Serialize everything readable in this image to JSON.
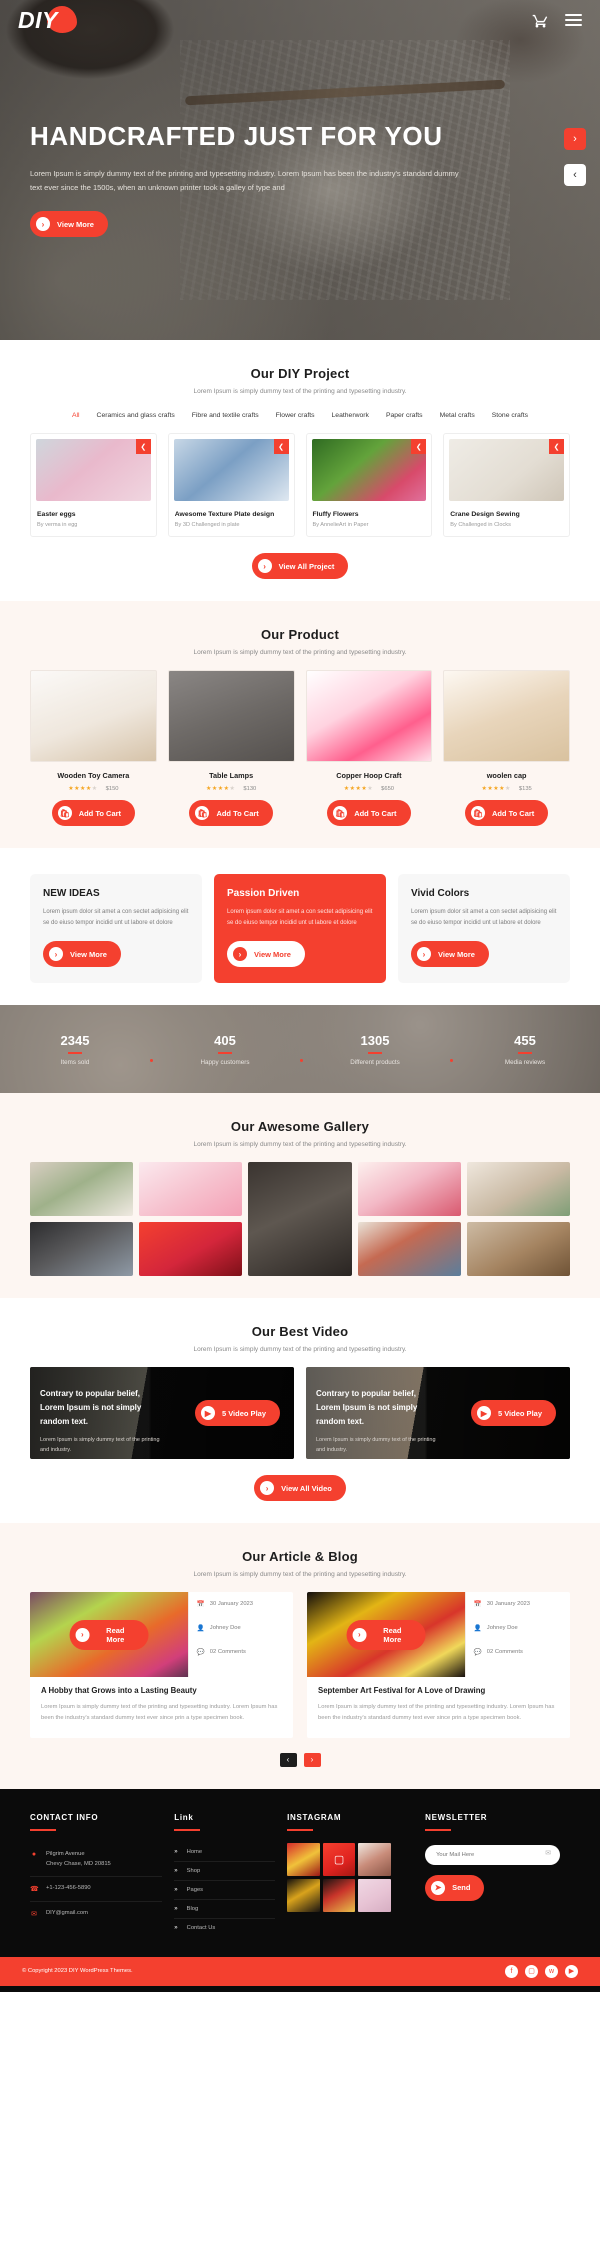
{
  "header": {
    "logo_text": "DIY",
    "cart_icon": "shopping-cart-icon",
    "menu_icon": "hamburger-menu-icon"
  },
  "hero": {
    "title": "HANDCRAFTED JUST FOR YOU",
    "subtitle": "Lorem Ipsum is simply dummy text of the printing and typesetting industry. Lorem Ipsum has been the industry's standard dummy text ever since the 1500s, when an unknown printer took a galley of type and",
    "cta_label": "View More",
    "next_label": "›",
    "prev_label": "‹"
  },
  "projects": {
    "title": "Our DIY Project",
    "subtitle": "Lorem Ipsum is simply dummy text of the printing and typesetting industry.",
    "filters": [
      {
        "label": "All",
        "active": true
      },
      {
        "label": "Ceramics and glass crafts",
        "active": false
      },
      {
        "label": "Fibre and textile crafts",
        "active": false
      },
      {
        "label": "Flower crafts",
        "active": false
      },
      {
        "label": "Leatherwork",
        "active": false
      },
      {
        "label": "Paper crafts",
        "active": false
      },
      {
        "label": "Metal crafts",
        "active": false
      },
      {
        "label": "Stone crafts",
        "active": false
      }
    ],
    "items": [
      {
        "name": "Easter eggs",
        "by": "By verma in egg"
      },
      {
        "name": "Awesome Texture Plate design",
        "by": "By 3D Challenged in plate"
      },
      {
        "name": "Fluffy Flowers",
        "by": "By AnnelieArt in Paper"
      },
      {
        "name": "Crane Design Sewing",
        "by": "By  Challenged in Clocks"
      }
    ],
    "share_icon": "share-icon",
    "cta_label": "View All Project"
  },
  "products": {
    "title": "Our Product",
    "subtitle": "Lorem Ipsum is simply dummy text of the printing and typesetting industry.",
    "add_to_cart_label": "Add To Cart",
    "cart_icon": "basket-icon",
    "items": [
      {
        "name": "Wooden Toy Camera",
        "price": "$150",
        "rating": 4
      },
      {
        "name": "Table Lamps",
        "price": "$130",
        "rating": 4
      },
      {
        "name": "Copper Hoop Craft",
        "price": "$650",
        "rating": 4
      },
      {
        "name": "woolen cap",
        "price": "$135",
        "rating": 4
      }
    ]
  },
  "features": {
    "items": [
      {
        "title": "NEW IDEAS",
        "text": "Lorem ipsum dolor sit amet a con sectet adipisicing elit se do eiuso tempor incidid unt ut labore et dolore",
        "cta": "View More",
        "highlight": false
      },
      {
        "title": "Passion Driven",
        "text": "Lorem ipsum dolor sit amet a con sectet adipisicing elit se do eiuso tempor incidid unt ut labore et dolore",
        "cta": "View More",
        "highlight": true
      },
      {
        "title": "Vivid Colors",
        "text": "Lorem ipsum dolor sit amet a con sectet adipisicing elit se do eiuso tempor incidid unt ut labore et dolore",
        "cta": "View More",
        "highlight": false
      }
    ]
  },
  "stats": {
    "items": [
      {
        "value": "2345",
        "label": "Items sold"
      },
      {
        "value": "405",
        "label": "Happy customers"
      },
      {
        "value": "1305",
        "label": "Different products"
      },
      {
        "value": "455",
        "label": "Media reviews"
      }
    ]
  },
  "gallery": {
    "title": "Our Awesome Gallery",
    "subtitle": "Lorem Ipsum is simply dummy text of the printing and typesetting industry."
  },
  "video": {
    "title": "Our Best Video",
    "subtitle": "Lorem Ipsum is simply dummy text of the printing and typesetting industry.",
    "items": [
      {
        "heading": "Contrary to popular belief, Lorem Ipsum is not simply random text.",
        "text": "Lorem Ipsum is simply dummy text of the printing and industry.",
        "play_label": "5 Video Play"
      },
      {
        "heading": "Contrary to popular belief, Lorem Ipsum is not simply random text.",
        "text": "Lorem Ipsum is simply dummy text of the printing and industry.",
        "play_label": "5 Video Play"
      }
    ],
    "cta_label": "View All Video"
  },
  "blog": {
    "title": "Our Article & Blog",
    "subtitle": "Lorem Ipsum is simply dummy text of the printing and typesetting industry.",
    "read_more_label": "Read More",
    "items": [
      {
        "date": "30 January 2023",
        "author": "Johney Doe",
        "comments": "02 Comments",
        "title": "A Hobby that Grows into a Lasting Beauty",
        "excerpt": "Lorem Ipsum is simply dummy text of the printing and typesetting industry. Lorem Ipsum has been the industry's standard dummy text ever since prin a type specimen book."
      },
      {
        "date": "30 January 2023",
        "author": "Johney Doe",
        "comments": "02 Comments",
        "title": "September Art Festival for A Love of Drawing",
        "excerpt": "Lorem Ipsum is simply dummy text of the printing and typesetting industry. Lorem Ipsum has been the industry's standard dummy text ever since prin a type specimen book."
      }
    ],
    "pager": [
      {
        "label": "‹",
        "active": false
      },
      {
        "label": "›",
        "active": true
      }
    ]
  },
  "footer": {
    "contact": {
      "heading": "CONTACT INFO",
      "rows": [
        {
          "icon": "location-pin-icon",
          "text": "Pilgrim Avenue\nChevy Chase, MD 20815"
        },
        {
          "icon": "phone-icon",
          "text": "+1-123-456-5890"
        },
        {
          "icon": "envelope-icon",
          "text": "DIY@gmail.com"
        }
      ]
    },
    "links": {
      "heading": "Link",
      "items": [
        "Home",
        "Shop",
        "Pages",
        "Blog",
        "Contact Us"
      ]
    },
    "instagram": {
      "heading": "INSTAGRAM",
      "icon": "instagram-icon"
    },
    "newsletter": {
      "heading": "NEWSLETTER",
      "placeholder": "Your Mail Here",
      "value": "",
      "mail_icon": "envelope-icon",
      "send_label": "Send",
      "send_icon": "paper-plane-icon"
    },
    "copyright": "© Copyright 2023 DIY WordPress Themes.",
    "socials": [
      "facebook-icon",
      "instagram-icon",
      "twitter-icon",
      "youtube-icon"
    ]
  },
  "colors": {
    "accent": "#f4402f",
    "dark": "#0b0b0b",
    "cream": "#fdf6f2"
  }
}
